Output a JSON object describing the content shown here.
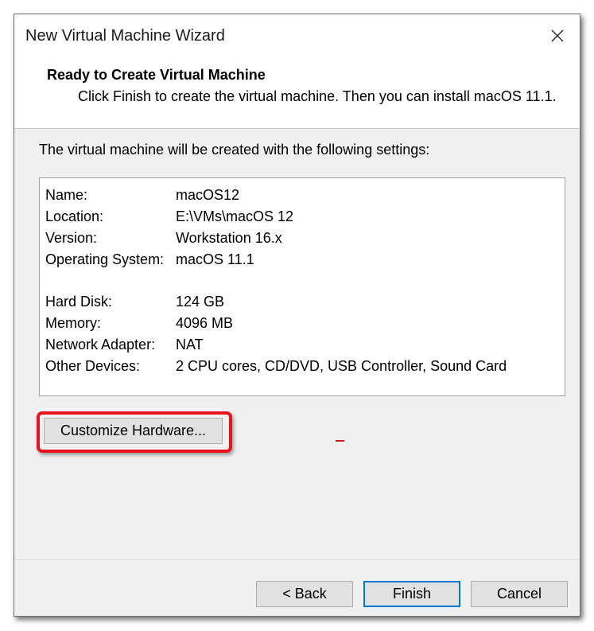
{
  "window": {
    "title": "New Virtual Machine Wizard"
  },
  "header": {
    "title": "Ready to Create Virtual Machine",
    "description": "Click Finish to create the virtual machine. Then you can install macOS 11.1."
  },
  "main": {
    "intro": "The virtual machine will be created with the following settings:",
    "settings": [
      {
        "label": "Name:",
        "value": "macOS12"
      },
      {
        "label": "Location:",
        "value": "E:\\VMs\\macOS 12"
      },
      {
        "label": "Version:",
        "value": "Workstation 16.x"
      },
      {
        "label": "Operating System:",
        "value": "macOS 11.1"
      },
      {
        "label": "Hard Disk:",
        "value": "124 GB"
      },
      {
        "label": "Memory:",
        "value": "4096 MB"
      },
      {
        "label": "Network Adapter:",
        "value": "NAT"
      },
      {
        "label": "Other Devices:",
        "value": "2 CPU cores, CD/DVD, USB Controller, Sound Card"
      }
    ],
    "customize_label": "Customize Hardware..."
  },
  "footer": {
    "back_label": "< Back",
    "finish_label": "Finish",
    "cancel_label": "Cancel"
  },
  "colors": {
    "highlight": "#e8141d",
    "focus": "#0078d7",
    "dialog_bg": "#f0f0f0"
  },
  "icons": {
    "close": "close-icon"
  }
}
